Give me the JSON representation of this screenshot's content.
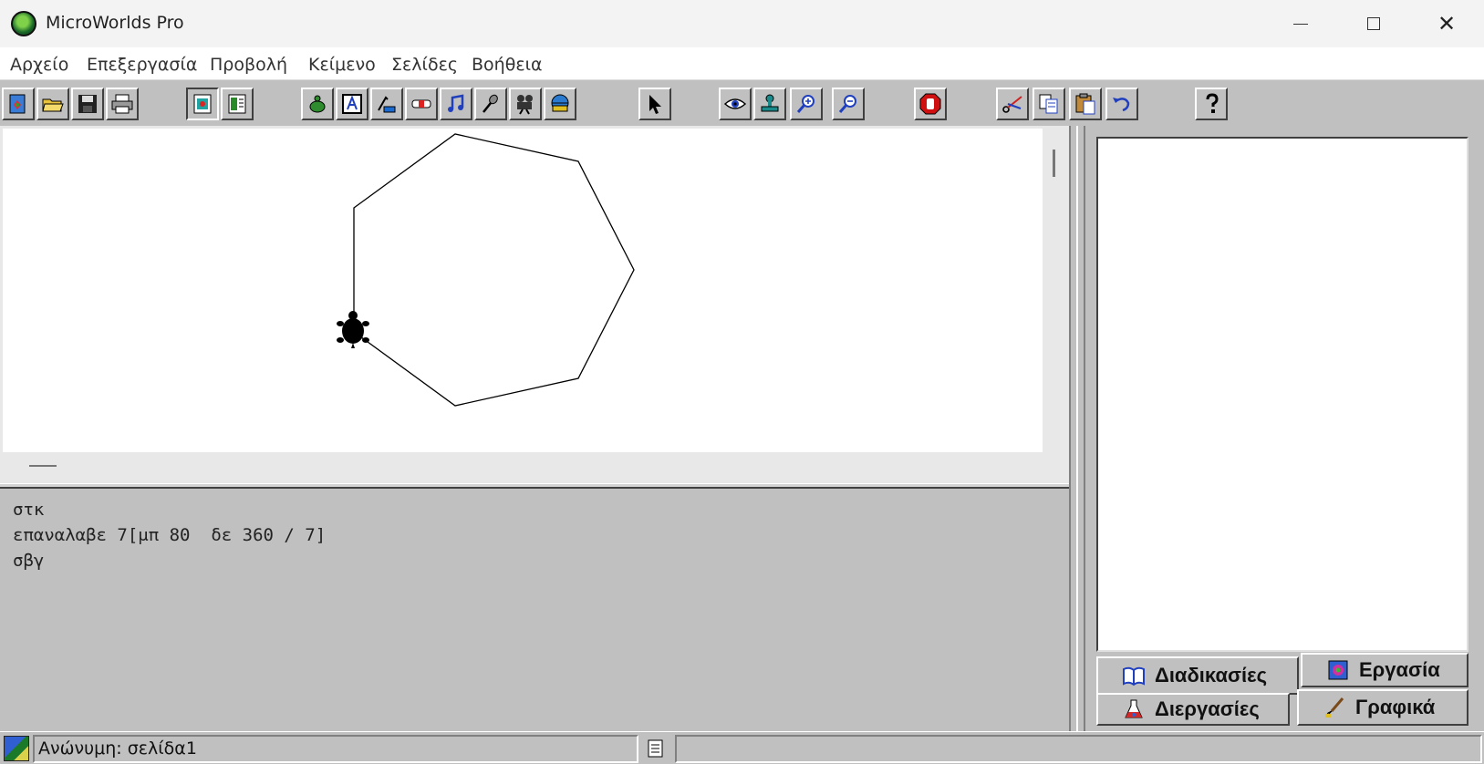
{
  "window": {
    "title": "MicroWorlds Pro",
    "controls": [
      "minimize",
      "maximize",
      "close"
    ],
    "close_glyph": "✕"
  },
  "menu": [
    "Αρχείο",
    "Επεξεργασία",
    "Προβολή",
    "Κείμενο",
    "Σελίδες",
    "Βοήθεια"
  ],
  "toolbar": {
    "buttons": [
      "new-project-icon",
      "open-folder-icon",
      "save-disk-icon",
      "print-icon",
      "page-view-icon",
      "text-view-icon",
      "new-turtle-icon",
      "text-box-icon",
      "button-icon",
      "slider-icon",
      "music-note-icon",
      "microphone-icon",
      "video-camera-icon",
      "globe-helmet-icon",
      "pointer-arrow-icon",
      "eye-icon",
      "stamp-icon",
      "zoom-in-icon",
      "zoom-out-icon",
      "stop-hand-icon",
      "scissors-icon",
      "copy-icon",
      "paste-icon",
      "undo-icon",
      "help-question-icon"
    ],
    "pressed": "page-view-icon"
  },
  "canvas": {
    "shape": "heptagon",
    "sides": 7,
    "turtle": "turtle-icon",
    "stroke_color": "#000000"
  },
  "command_center": {
    "lines": [
      "στκ",
      "επαναλαβε 7[μπ 80  δε 360 / 7]",
      "σβγ"
    ]
  },
  "right_pane": {
    "tabs": [
      {
        "label": "Διαδικασίες",
        "icon": "book-icon",
        "active": true
      },
      {
        "label": "Εργασία",
        "icon": "project-icon",
        "active": false
      },
      {
        "label": "Διεργασίες",
        "icon": "flask-icon",
        "active": false
      },
      {
        "label": "Γραφικά",
        "icon": "paintbrush-icon",
        "active": false
      }
    ]
  },
  "status": {
    "text": "Ανώνυμη:  σελίδα1"
  }
}
